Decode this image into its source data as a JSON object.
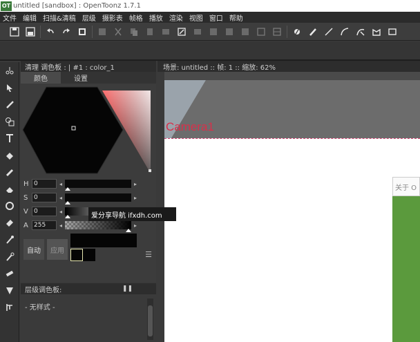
{
  "window": {
    "logo": "OT",
    "title": "untitled [sandbox] : OpenToonz 1.7.1"
  },
  "menu": [
    "文件",
    "编辑",
    "扫描&清稿",
    "层级",
    "摄影表",
    "帧格",
    "播放",
    "渲染",
    "视图",
    "窗口",
    "帮助"
  ],
  "toolbar_icons": [
    "save-scene-icon",
    "save-all-icon",
    "undo-icon",
    "redo-icon",
    "stamp-icon",
    "grid-icon",
    "scissors-icon",
    "copy-icon",
    "paste-icon",
    "film-icon",
    "film2-icon",
    "export-icon",
    "fx-icon",
    "levels-icon",
    "cells-icon",
    "stack-icon",
    "frame-icon",
    "cells2-icon",
    "flip-icon",
    "pen-tool-icon",
    "brush-tool-icon",
    "line-icon",
    "arc-icon",
    "curve-icon",
    "shape-icon",
    "rect-icon"
  ],
  "tools": [
    "animate-tool",
    "selection-tool",
    "brush-tool",
    "geometric-tool",
    "type-tool",
    "fill-tool",
    "paint-brush-tool",
    "eraser-tool",
    "tape-tool",
    "style-picker-tool",
    "rgb-picker-tool",
    "control-point-tool",
    "pinch-tool",
    "pump-tool",
    "magnet-tool"
  ],
  "style_panel": {
    "title": "清理 调色板 : | #1 : color_1",
    "tabs": [
      "颜色",
      "设置"
    ],
    "channels": [
      {
        "label": "H",
        "value": "0",
        "fraction": 0.0
      },
      {
        "label": "S",
        "value": "0",
        "fraction": 0.0
      },
      {
        "label": "V",
        "value": "0",
        "fraction": 0.0
      },
      {
        "label": "A",
        "value": "255",
        "fraction": 1.0
      }
    ],
    "auto_label": "自动",
    "apply_label": "应用"
  },
  "level_panel": {
    "title": "层级调色板:",
    "pause_icon": "❚❚",
    "body": "- 无样式 -"
  },
  "scene": {
    "header": "场景: untitled  ::  帧: 1  ::  缩放: 62%",
    "camera_label": "Camera1"
  },
  "dialog": {
    "title": "关于 O"
  },
  "watermark": "爱分享导航 ifxdh.com",
  "colors": {
    "accent_camera": "#d8304a",
    "dialog_green": "#5b9a3d"
  }
}
